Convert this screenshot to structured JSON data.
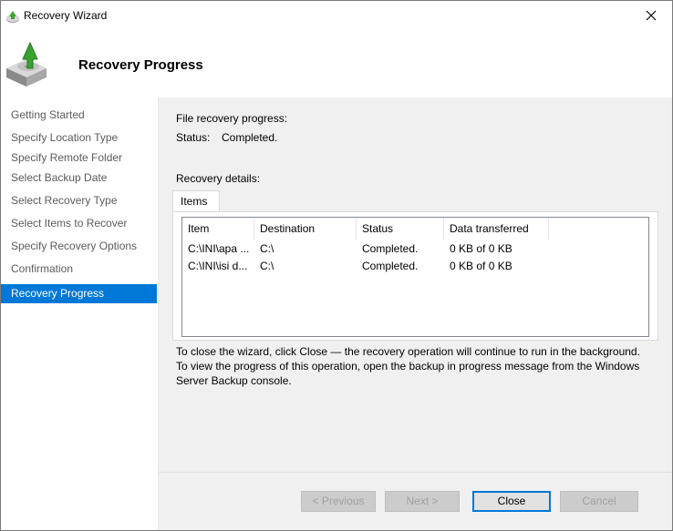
{
  "window": {
    "title": "Recovery Wizard"
  },
  "header": {
    "title": "Recovery Progress"
  },
  "sidebar": {
    "steps": [
      {
        "label": "Getting Started"
      },
      {
        "label": "Specify Location Type"
      },
      {
        "label": "Specify Remote Folder"
      },
      {
        "label": "Select Backup Date"
      },
      {
        "label": "Select Recovery Type"
      },
      {
        "label": "Select Items to Recover"
      },
      {
        "label": "Specify Recovery Options"
      },
      {
        "label": "Confirmation"
      },
      {
        "label": "Recovery Progress"
      }
    ],
    "active_step": "Recovery Progress"
  },
  "progress": {
    "label": "File recovery progress:",
    "status_label": "Status:",
    "status_value": "Completed."
  },
  "details": {
    "label": "Recovery details:",
    "tab": "Items",
    "columns": [
      "Item",
      "Destination",
      "Status",
      "Data transferred"
    ],
    "rows": [
      {
        "item": "C:\\INI\\apa ...",
        "destination": "C:\\",
        "status": "Completed.",
        "transferred": "0 KB of 0 KB"
      },
      {
        "item": "C:\\INI\\isi d...",
        "destination": "C:\\",
        "status": "Completed.",
        "transferred": "0 KB of 0 KB"
      }
    ]
  },
  "note": {
    "line1": "To close the wizard, click Close — the recovery operation will continue to run in the background.",
    "line2": "To view the progress of this operation, open the backup in progress message from the Windows",
    "line3": "Server Backup console."
  },
  "buttons": {
    "previous": "< Previous",
    "next": "Next >",
    "close": "Close",
    "cancel": "Cancel"
  },
  "colors": {
    "accent": "#0078d7",
    "content_bg": "#f0f0f0"
  }
}
